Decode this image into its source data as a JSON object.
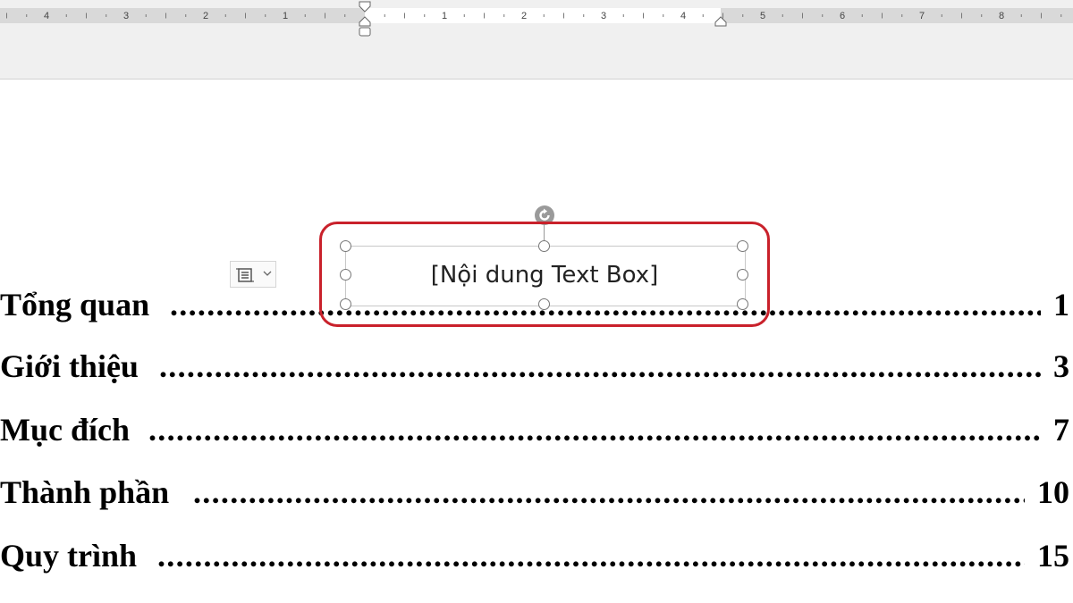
{
  "ruler": {
    "labels": [
      "4",
      "3",
      "2",
      "1",
      "1",
      "2",
      "3",
      "4",
      "5",
      "6",
      "7",
      "8"
    ]
  },
  "textbox": {
    "content": "[Nội dung Text Box]"
  },
  "toc": {
    "entries": [
      {
        "title": "Tổng quan",
        "page": "1"
      },
      {
        "title": "Giới thiệu",
        "page": "3"
      },
      {
        "title": "Mục đích",
        "page": "7"
      },
      {
        "title": "Thành phần",
        "page": "10"
      },
      {
        "title": "Quy trình",
        "page": "15"
      }
    ]
  },
  "colors": {
    "highlight": "#c9212b",
    "ruler_track": "#d9d9d9",
    "ribbon_bg": "#f0f0f0"
  },
  "icons": {
    "layout_options": "layout-options-icon",
    "dropdown": "chevron-down-icon",
    "rotate": "rotate-handle-icon"
  }
}
